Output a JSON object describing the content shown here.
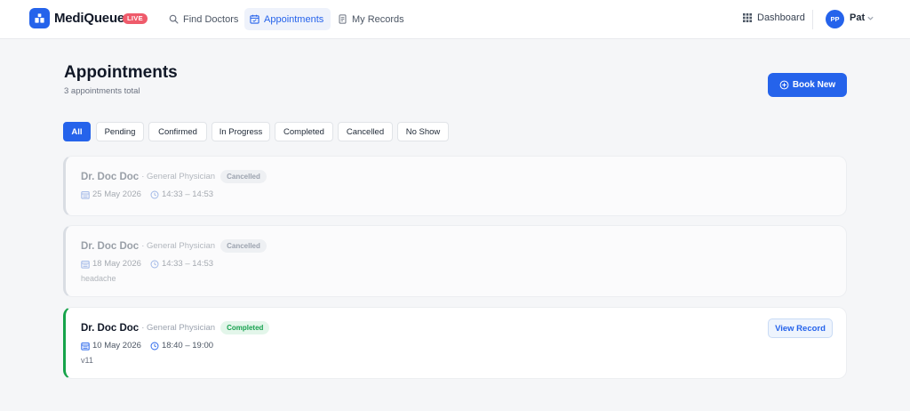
{
  "app": {
    "brand": "MediQueue",
    "badge": "LIVE",
    "colors": {
      "accent": "#2563eb",
      "live": "#ef5b6b",
      "success": "#16a34a"
    }
  },
  "nav": {
    "items": [
      {
        "label": "Find Doctors",
        "icon": "search-icon",
        "active": false
      },
      {
        "label": "Appointments",
        "icon": "calendar-icon",
        "active": true
      },
      {
        "label": "My Records",
        "icon": "document-icon",
        "active": false
      }
    ],
    "dashboard": "Dashboard",
    "user": {
      "initials": "PP",
      "name": "Pat"
    }
  },
  "page": {
    "title": "Appointments",
    "subtitle": "3 appointments total",
    "book_button": "Book New"
  },
  "filters": [
    "All",
    "Pending",
    "Confirmed",
    "In Progress",
    "Completed",
    "Cancelled",
    "No Show"
  ],
  "active_filter": "All",
  "appointments": [
    {
      "doctor": "Dr. Doc Doc",
      "specialty": "· General Physician",
      "status": "Cancelled",
      "date": "25 May 2026",
      "time": "14:33 – 14:53",
      "note": ""
    },
    {
      "doctor": "Dr. Doc Doc",
      "specialty": "· General Physician",
      "status": "Cancelled",
      "date": "18 May 2026",
      "time": "14:33 – 14:53",
      "note": "headache"
    },
    {
      "doctor": "Dr. Doc Doc",
      "specialty": "· General Physician",
      "status": "Completed",
      "date": "10 May 2026",
      "time": "18:40 – 19:00",
      "note": "v11",
      "action": "View Record"
    }
  ]
}
